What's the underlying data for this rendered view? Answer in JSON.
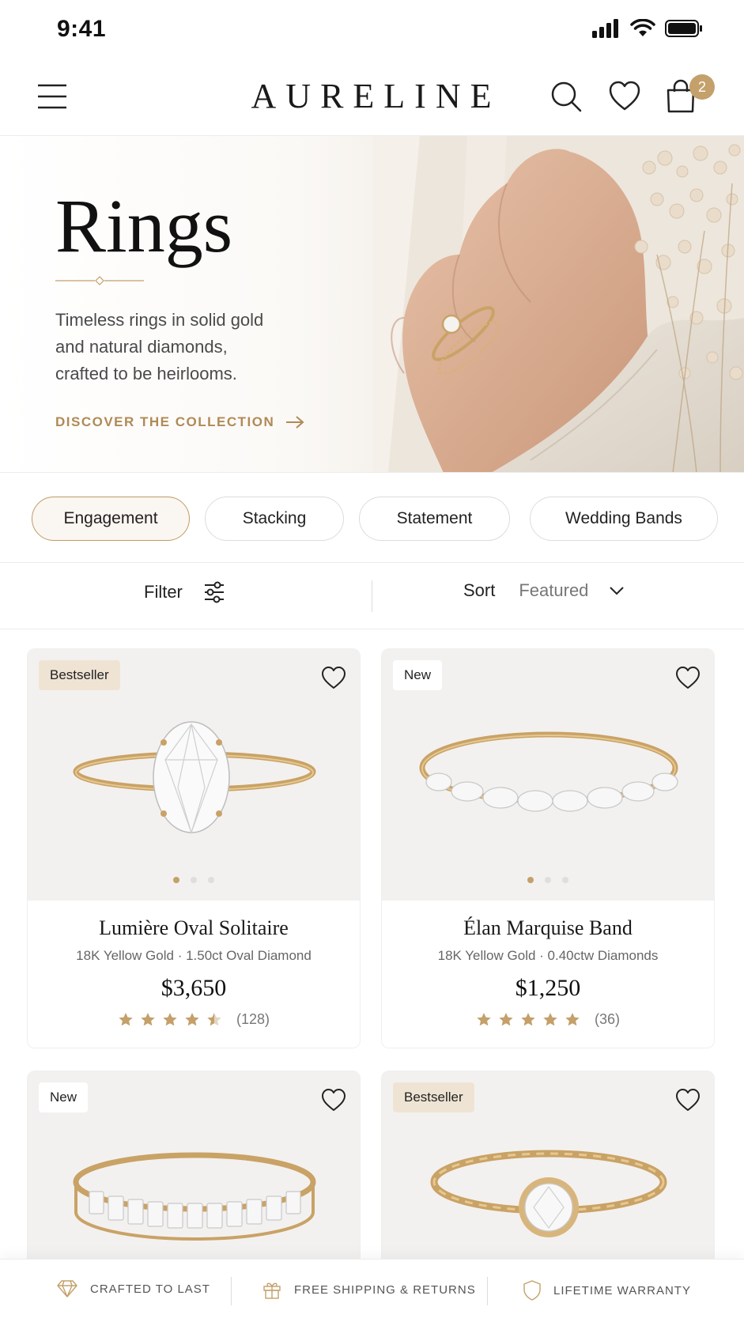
{
  "status_bar": {
    "time": "9:41"
  },
  "header": {
    "brand": "AURELINE",
    "cart_count": "2"
  },
  "hero": {
    "title": "Rings",
    "description": "Timeless rings in solid gold and natural diamonds, crafted to be heirlooms.",
    "cta": "DISCOVER THE COLLECTION"
  },
  "categories": [
    {
      "label": "Engagement",
      "active": true
    },
    {
      "label": "Stacking",
      "active": false
    },
    {
      "label": "Statement",
      "active": false
    },
    {
      "label": "Wedding Bands",
      "active": false
    }
  ],
  "toolbar": {
    "filter_label": "Filter",
    "sort_label": "Sort",
    "sort_value": "Featured"
  },
  "products": [
    {
      "badge": "Bestseller",
      "name": "Lumière Oval Solitaire",
      "spec": "18K Yellow Gold · 1.50ct Oval Diamond",
      "price": "$3,650",
      "rating": 4.5,
      "reviews": "(128)"
    },
    {
      "badge": "New",
      "name": "Élan Marquise Band",
      "spec": "18K Yellow Gold · 0.40ctw Diamonds",
      "price": "$1,250",
      "rating": 5,
      "reviews": "(36)"
    },
    {
      "badge": "New"
    },
    {
      "badge": "Bestseller"
    }
  ],
  "trust": [
    {
      "label": "CRAFTED TO LAST",
      "icon": "diamond-icon"
    },
    {
      "label": "FREE SHIPPING & RETURNS",
      "icon": "gift-icon"
    },
    {
      "label": "LIFETIME WARRANTY",
      "icon": "shield-icon"
    }
  ],
  "colors": {
    "accent": "#c4a06a",
    "cta": "#b08a56",
    "badge_bestseller": "#efe4d4",
    "card_bg": "#f3f1ef"
  }
}
